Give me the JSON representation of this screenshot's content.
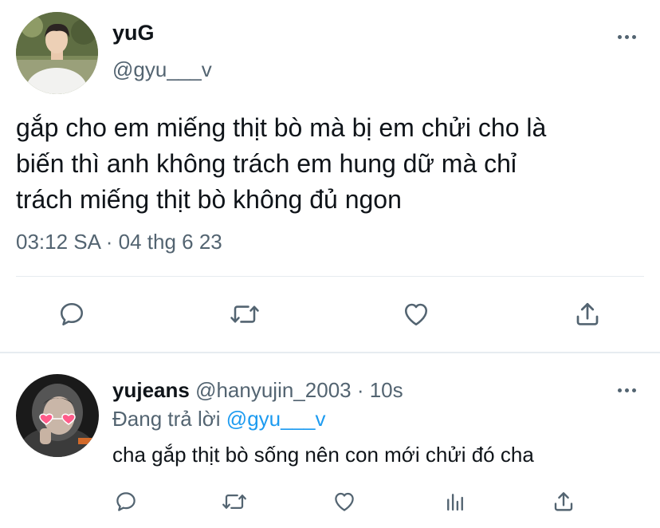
{
  "main_tweet": {
    "author_name": "yuG",
    "author_handle": "@gyu___v",
    "text_lines": [
      "gắp cho em miếng thịt bò mà bị em chửi cho là",
      "biến thì anh không trách em hung dữ mà chỉ",
      "trách miếng thịt bò không đủ ngon"
    ],
    "timestamp": "03:12 SA · 04 thg 6 23",
    "actions": [
      "reply-icon",
      "retweet-icon",
      "like-icon",
      "share-icon"
    ]
  },
  "reply": {
    "author_name": "yujeans",
    "meta": "@hanyujin_2003 · 10s",
    "replying_to_label": "Đang trả lời",
    "replying_to_handle": "@gyu___v",
    "text": "cha gắp thịt bò sống nên con mới chửi đó cha",
    "actions": [
      "reply-icon",
      "retweet-icon",
      "like-icon",
      "views-icon",
      "share-icon"
    ]
  },
  "colors": {
    "text": "#0f1419",
    "muted": "#536471",
    "link": "#1d9bf0",
    "divider": "#e6ecf0",
    "heart_glasses": "#ff5c8a"
  }
}
